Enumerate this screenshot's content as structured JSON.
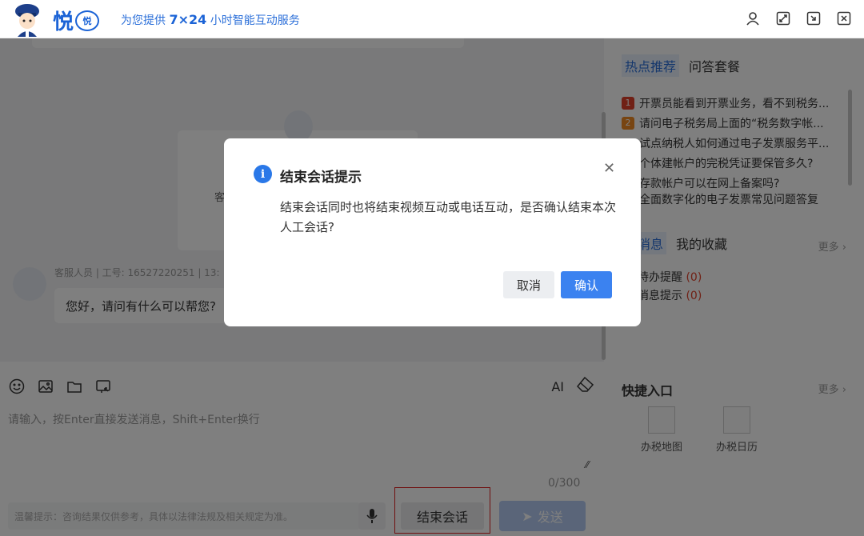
{
  "header": {
    "logo_char": "悦",
    "logo_badge": "悦",
    "tagline_prefix": "为您提供 ",
    "tagline_bold": "7×24",
    "tagline_suffix": " 小时智能互动服务",
    "icons": [
      "user-icon",
      "fullscreen-icon",
      "minimize-icon",
      "close-icon"
    ]
  },
  "chat": {
    "center_card_text": "客",
    "agent_meta": "客服人员 | 工号: 16527220251 | 13:",
    "agent_message": "您好，请问有什么可以帮您?"
  },
  "input": {
    "toolbar_icons": [
      "emoji-icon",
      "image-icon",
      "folder-icon",
      "screenshot-icon"
    ],
    "ai_label": "AI",
    "placeholder": "请输入，按Enter直接发送消息，Shift+Enter换行",
    "char_count": "0/300",
    "footer_tip": "温馨提示：咨询结果仅供参考，具体以法律法规及相关规定为准。",
    "end_button": "结束会话",
    "send_button": "发送"
  },
  "right": {
    "tabs": [
      "热点推荐",
      "问答套餐"
    ],
    "hot_items": [
      {
        "rank": "1",
        "text": "开票员能看到开票业务，看不到税务..."
      },
      {
        "rank": "2",
        "text": "请问电子税务局上面的“税务数字帐..."
      },
      {
        "rank": "",
        "text": "试点纳税人如何通过电子发票服务平..."
      },
      {
        "rank": "",
        "text": "个体建帐户的完税凭证要保管多久?"
      },
      {
        "rank": "",
        "text": "存款帐户可以在网上备案吗?"
      },
      {
        "rank": "",
        "text": "全面数字化的电子发票常见问题答复"
      }
    ],
    "msg_tabs": [
      "的消息",
      "我的收藏"
    ],
    "more": "更多",
    "msg_items": [
      {
        "label": "待办提醒",
        "count": "(0)"
      },
      {
        "label": "消息提示",
        "count": "(0)"
      }
    ],
    "quick_title": "快捷入口",
    "quick_more": "更多",
    "quick_items": [
      "办税地图",
      "办税日历"
    ]
  },
  "dialog": {
    "title": "结束会话提示",
    "body": "结束会话同时也将结束视频互动或电话互动，是否确认结束本次人工会话?",
    "cancel": "取消",
    "confirm": "确认"
  }
}
